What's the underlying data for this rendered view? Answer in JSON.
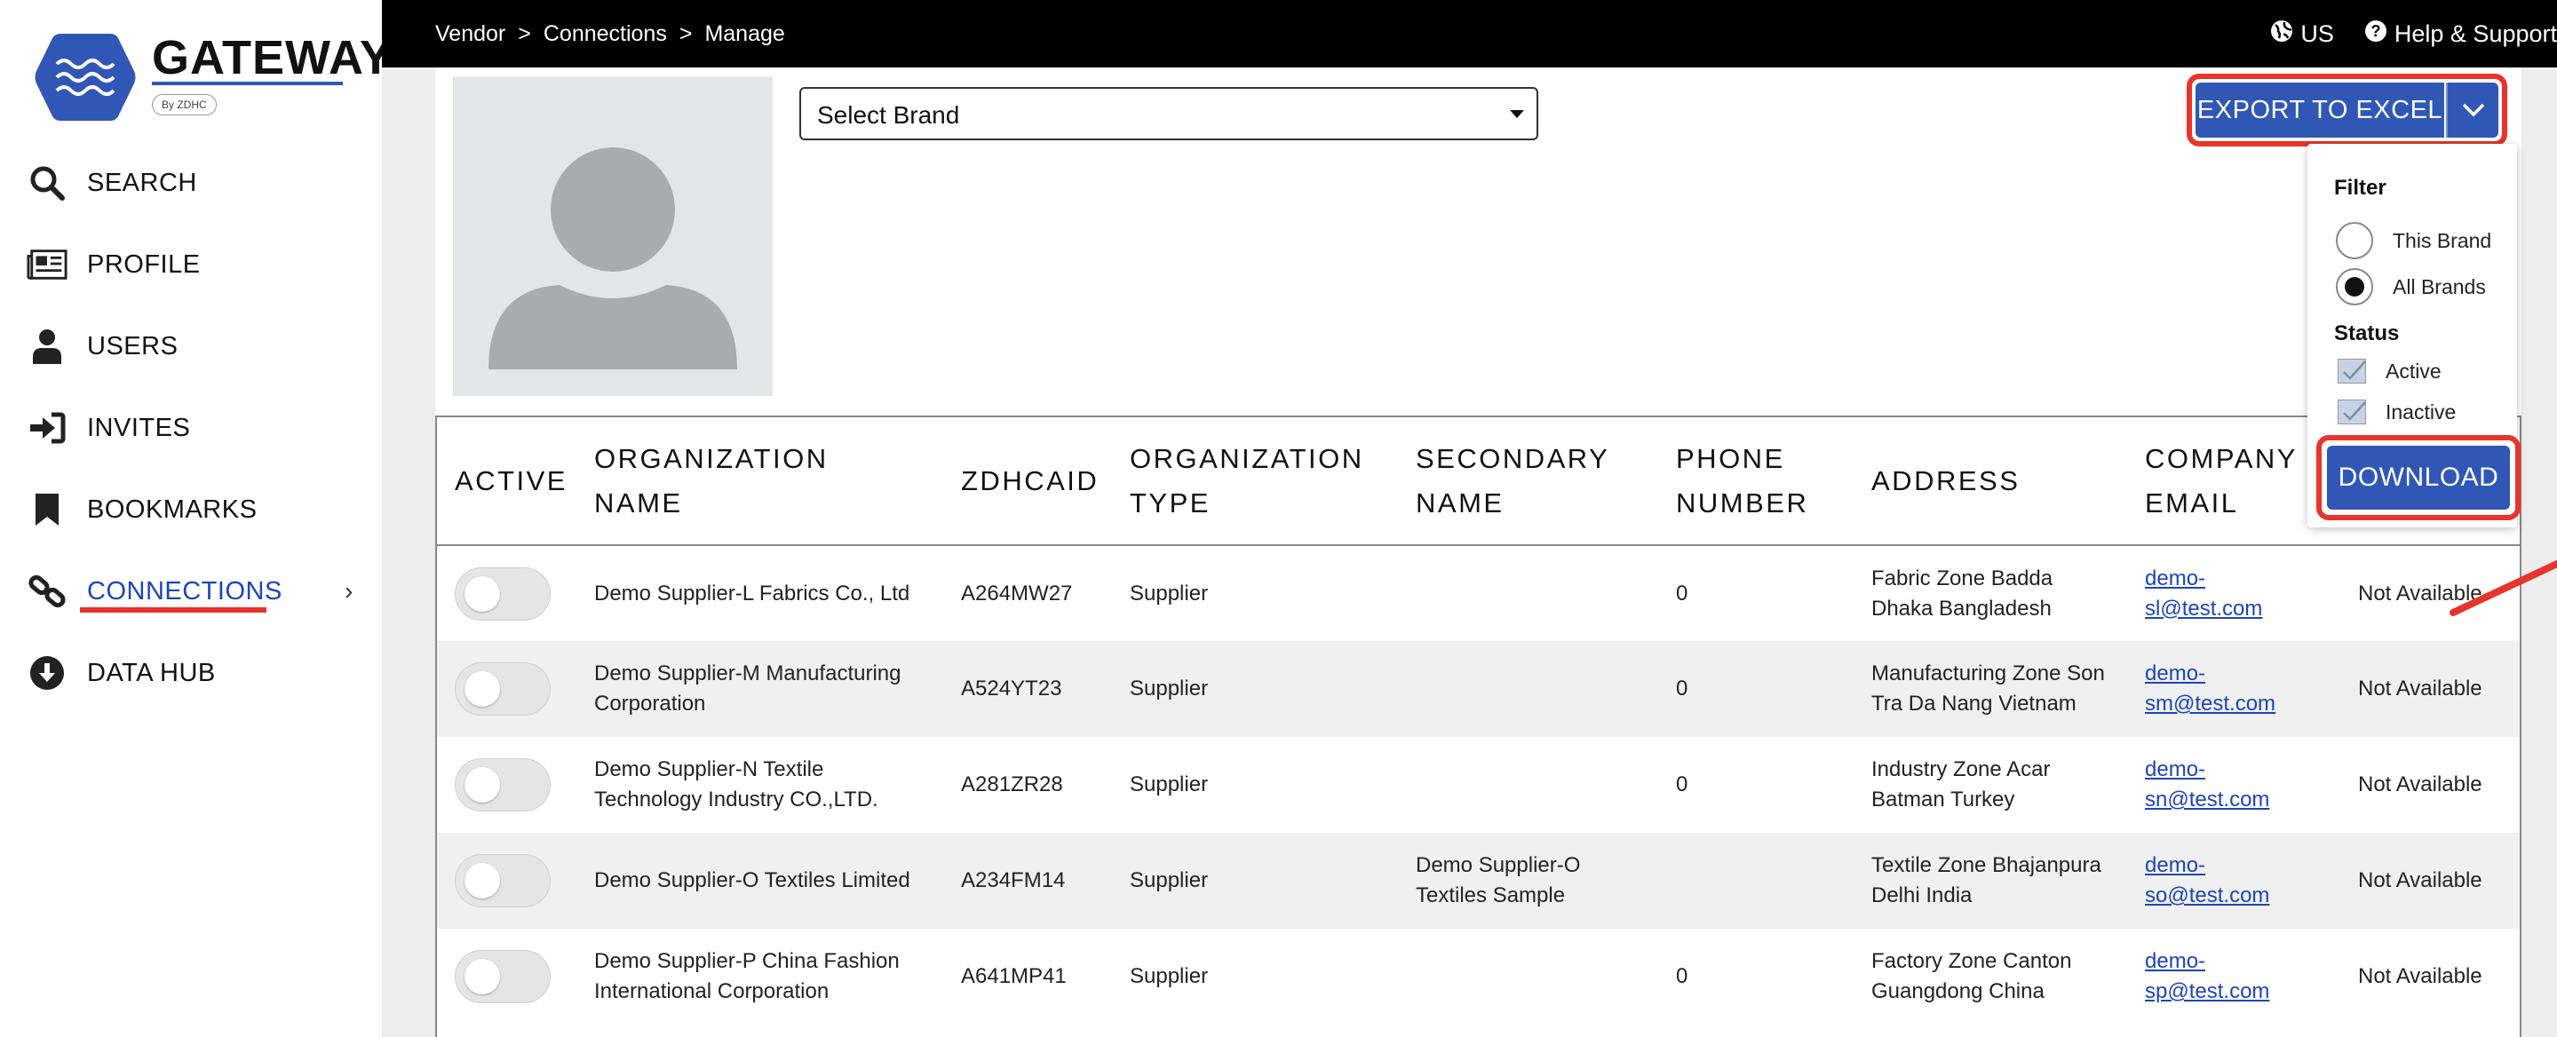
{
  "logo": {
    "title": "GATEWAY",
    "byline": "By ZDHC"
  },
  "sidebar": {
    "items": [
      {
        "label": "SEARCH",
        "icon": "search-icon"
      },
      {
        "label": "PROFILE",
        "icon": "newspaper-icon"
      },
      {
        "label": "USERS",
        "icon": "user-icon"
      },
      {
        "label": "INVITES",
        "icon": "sign-in-icon"
      },
      {
        "label": "BOOKMARKS",
        "icon": "bookmark-icon"
      },
      {
        "label": "CONNECTIONS",
        "icon": "link-icon",
        "active": true
      },
      {
        "label": "DATA HUB",
        "icon": "download-circle-icon"
      }
    ]
  },
  "topbar": {
    "breadcrumb": [
      "Vendor",
      "Connections",
      "Manage"
    ],
    "separator": ">",
    "region": "US",
    "help": "Help & Support"
  },
  "brand_select": {
    "value": "Select Brand"
  },
  "export": {
    "label": "EXPORT TO EXCEL",
    "filter_heading": "Filter",
    "filter_options": [
      "This Brand",
      "All Brands"
    ],
    "filter_selected": "All Brands",
    "status_heading": "Status",
    "status_options": [
      "Active",
      "Inactive"
    ],
    "download_label": "DOWNLOAD"
  },
  "table": {
    "headers": [
      "ACTIVE",
      "ORGANIZATION NAME",
      "ZDHCAID",
      "ORGANIZATION TYPE",
      "SECONDARY NAME",
      "PHONE NUMBER",
      "ADDRESS",
      "COMPANY EMAIL",
      ""
    ],
    "rows": [
      {
        "name": "Demo Supplier-L Fabrics Co., Ltd",
        "aid": "A264MW27",
        "type": "Supplier",
        "secondary": "",
        "phone": "0",
        "address": "Fabric Zone Badda Dhaka Bangladesh",
        "email": "demo-sl@test.com",
        "extra": "Not Available"
      },
      {
        "name": "Demo Supplier-M Manufacturing Corporation",
        "aid": "A524YT23",
        "type": "Supplier",
        "secondary": "",
        "phone": "0",
        "address": "Manufacturing Zone Son Tra Da Nang Vietnam",
        "email": "demo-sm@test.com",
        "extra": "Not Available"
      },
      {
        "name": "Demo Supplier-N Textile Technology Industry CO.,LTD.",
        "aid": "A281ZR28",
        "type": "Supplier",
        "secondary": "",
        "phone": "0",
        "address": "Industry Zone Acar Batman Turkey",
        "email": "demo-sn@test.com",
        "extra": "Not Available"
      },
      {
        "name": "Demo Supplier-O Textiles Limited",
        "aid": "A234FM14",
        "type": "Supplier",
        "secondary": "Demo Supplier-O Textiles Sample",
        "phone": "",
        "address": "Textile Zone Bhajanpura Delhi India",
        "email": "demo-so@test.com",
        "extra": "Not Available"
      },
      {
        "name": "Demo Supplier-P China Fashion International Corporation",
        "aid": "A641MP41",
        "type": "Supplier",
        "secondary": "",
        "phone": "0",
        "address": "Factory Zone Canton Guangdong China",
        "email": "demo-sp@test.com",
        "extra": "Not Available"
      }
    ]
  },
  "colors": {
    "accent": "#3057b6",
    "highlight": "#e8342a",
    "active_nav": "#1c45b8"
  }
}
